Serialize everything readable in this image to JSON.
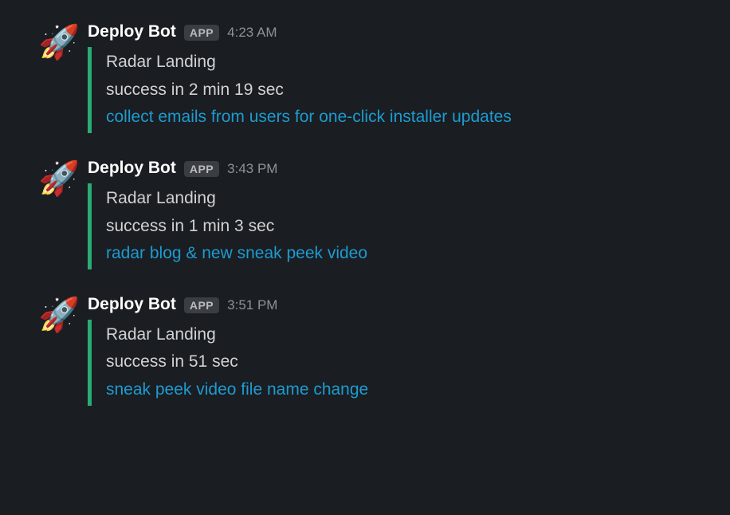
{
  "badge_label": "APP",
  "messages": [
    {
      "sender": "Deploy Bot",
      "timestamp": "4:23 AM",
      "attachment": {
        "title": "Radar Landing",
        "status": "success in 2 min 19 sec",
        "link": "collect emails from users for one-click installer updates"
      }
    },
    {
      "sender": "Deploy Bot",
      "timestamp": "3:43 PM",
      "attachment": {
        "title": "Radar Landing",
        "status": "success in 1 min 3 sec",
        "link": "radar blog & new sneak peek video"
      }
    },
    {
      "sender": "Deploy Bot",
      "timestamp": "3:51 PM",
      "attachment": {
        "title": "Radar Landing",
        "status": "success in 51 sec",
        "link": "sneak peek video file name change"
      }
    }
  ]
}
